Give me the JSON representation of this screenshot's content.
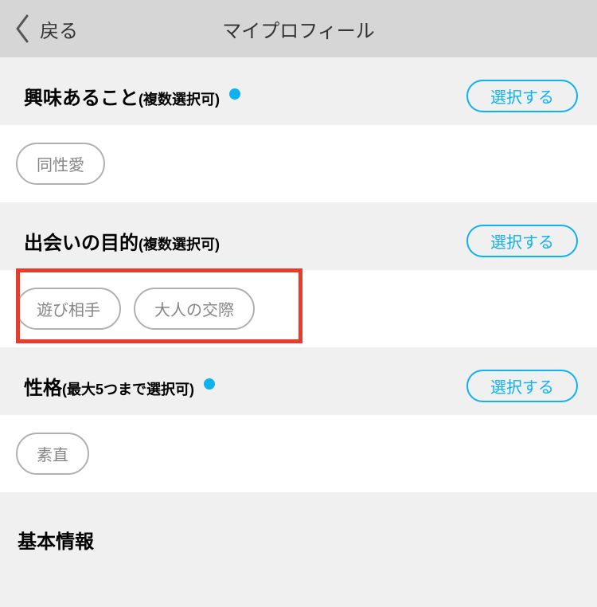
{
  "header": {
    "back_label": "戻る",
    "title": "マイプロフィール"
  },
  "sections": {
    "interests": {
      "title": "興味あること",
      "subtitle": "(複数選択可)",
      "has_dot": true,
      "select_label": "選択する",
      "chips": [
        "同性愛"
      ]
    },
    "purpose": {
      "title": "出会いの目的",
      "subtitle": "(複数選択可)",
      "has_dot": false,
      "select_label": "選択する",
      "chips": [
        "遊び相手",
        "大人の交際"
      ]
    },
    "personality": {
      "title": "性格",
      "subtitle": "(最大5つまで選択可)",
      "has_dot": true,
      "select_label": "選択する",
      "chips": [
        "素直"
      ]
    }
  },
  "basic_info_title": "基本情報"
}
